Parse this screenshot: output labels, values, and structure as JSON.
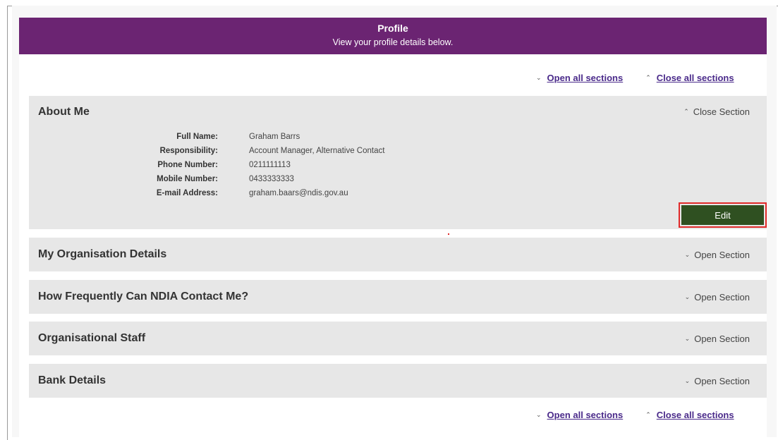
{
  "header": {
    "title": "Profile",
    "subtitle": "View your profile details below."
  },
  "toggles": {
    "open_all": "Open all sections",
    "close_all": "Close all sections"
  },
  "sections": {
    "about": {
      "title": "About Me",
      "toggle": "Close Section",
      "state": "expanded",
      "fields": [
        {
          "label": "Full Name:",
          "value": "Graham Barrs"
        },
        {
          "label": "Responsibility:",
          "value": "Account Manager,  Alternative Contact"
        },
        {
          "label": "Phone Number:",
          "value": "0211111113"
        },
        {
          "label": "Mobile Number:",
          "value": "0433333333"
        },
        {
          "label": "E-mail Address:",
          "value": "graham.baars@ndis.gov.au"
        }
      ],
      "edit_label": "Edit"
    },
    "org": {
      "title": "My Organisation Details",
      "toggle": "Open Section",
      "state": "collapsed"
    },
    "freq": {
      "title": "How Frequently Can NDIA Contact Me?",
      "toggle": "Open Section",
      "state": "collapsed"
    },
    "staff": {
      "title": "Organisational Staff",
      "toggle": "Open Section",
      "state": "collapsed"
    },
    "bank": {
      "title": "Bank Details",
      "toggle": "Open Section",
      "state": "collapsed"
    }
  },
  "colors": {
    "header_bg": "#6b2472",
    "section_bg": "#e7e7e7",
    "edit_bg": "#2f5021",
    "highlight": "#e02a2a",
    "link": "#4a2a8a"
  },
  "icons": {
    "expand": "chevron-down-icon",
    "collapse": "chevron-up-icon"
  }
}
